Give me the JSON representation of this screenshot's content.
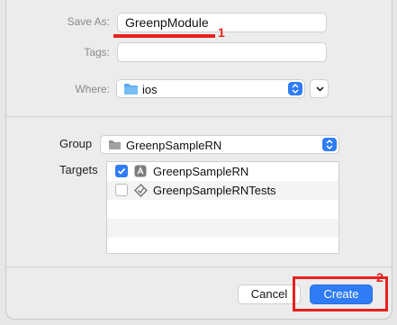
{
  "save_as": {
    "label": "Save As:",
    "value": "GreenpModule"
  },
  "tags": {
    "label": "Tags:",
    "value": ""
  },
  "where": {
    "label": "Where:",
    "value": "ios"
  },
  "group": {
    "label": "Group",
    "value": "GreenpSampleRN"
  },
  "targets": {
    "label": "Targets",
    "items": [
      {
        "label": "GreenpSampleRN",
        "checked": true,
        "icon": "app-target-icon"
      },
      {
        "label": "GreenpSampleRNTests",
        "checked": false,
        "icon": "test-target-icon"
      }
    ]
  },
  "buttons": {
    "cancel": "Cancel",
    "create": "Create"
  },
  "annotations": {
    "one": "1",
    "two": "2"
  },
  "colors": {
    "accent": "#2f7cf6",
    "annotation": "#e8211d"
  }
}
